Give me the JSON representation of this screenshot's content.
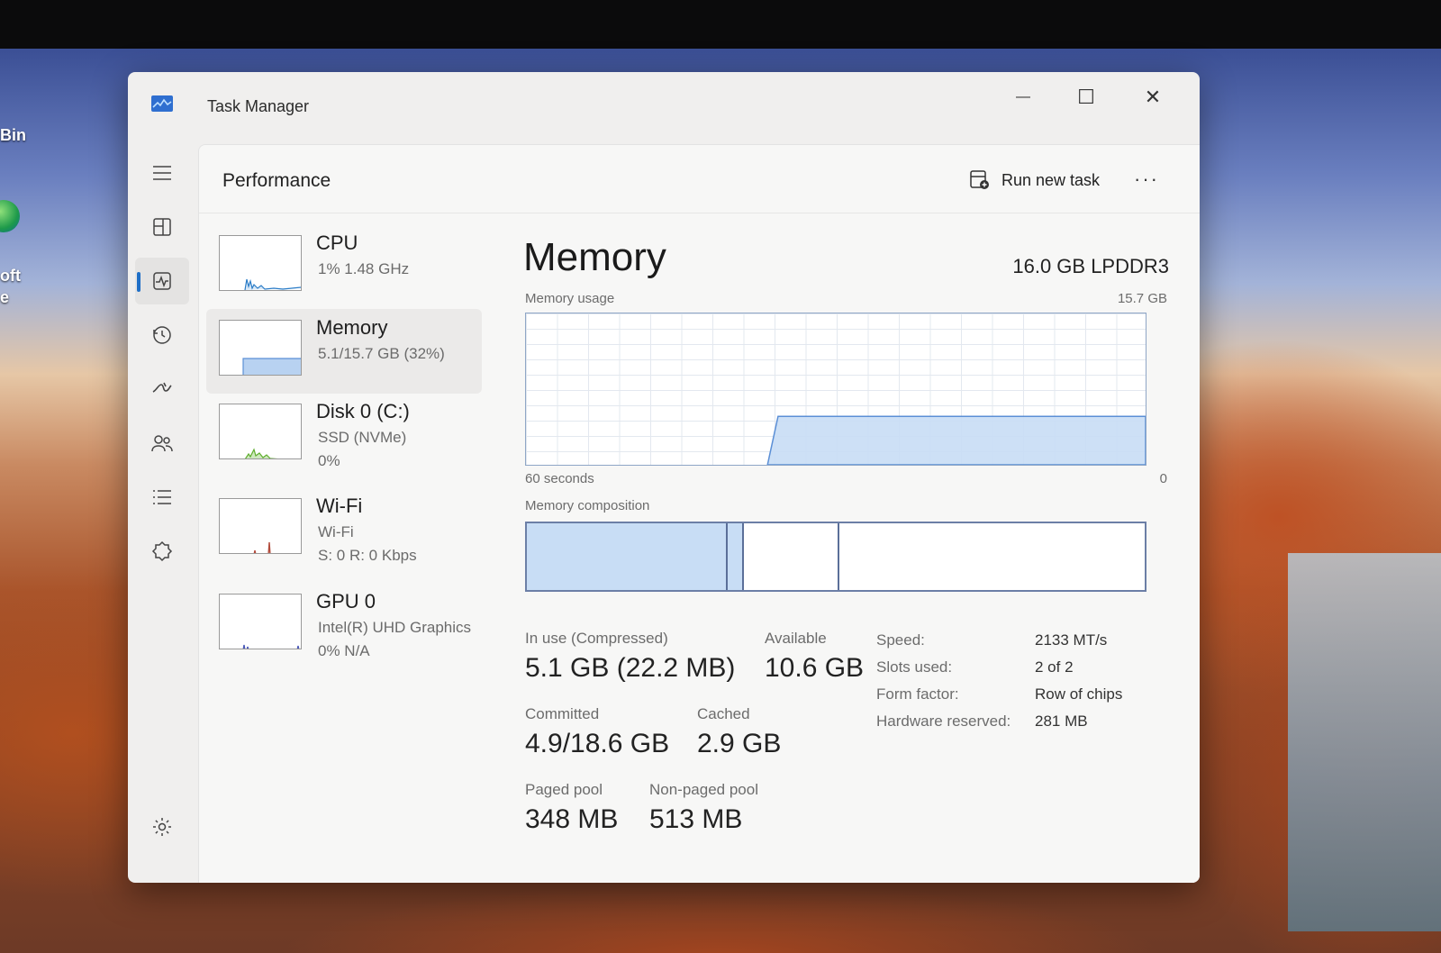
{
  "desktop": {
    "icon_labels": [
      "Bin",
      "oft",
      "e"
    ]
  },
  "window": {
    "title": "Task Manager",
    "controls": {
      "minimize": "—",
      "maximize": "☐",
      "close": "✕"
    }
  },
  "nav": {
    "items": [
      {
        "name": "menu-icon"
      },
      {
        "name": "processes-icon"
      },
      {
        "name": "performance-icon",
        "active": true
      },
      {
        "name": "app-history-icon"
      },
      {
        "name": "startup-apps-icon"
      },
      {
        "name": "users-icon"
      },
      {
        "name": "details-icon"
      },
      {
        "name": "services-icon"
      },
      {
        "name": "settings-icon"
      }
    ]
  },
  "header": {
    "title": "Performance",
    "run_new_task": "Run new task",
    "more": "···"
  },
  "devices": [
    {
      "name": "CPU",
      "sub1": "1%  1.48 GHz",
      "sub2": "",
      "sub3": "",
      "color": "#2a7cc7"
    },
    {
      "name": "Memory",
      "sub1": "5.1/15.7 GB (32%)",
      "sub2": "",
      "sub3": "",
      "color": "#5b8fd6",
      "active": true
    },
    {
      "name": "Disk 0 (C:)",
      "sub1": "SSD (NVMe)",
      "sub2": "0%",
      "sub3": "",
      "color": "#5fae2e"
    },
    {
      "name": "Wi-Fi",
      "sub1": "Wi-Fi",
      "sub2": "S: 0  R: 0 Kbps",
      "sub3": "",
      "color": "#b24a3a"
    },
    {
      "name": "GPU 0",
      "sub1": "Intel(R) UHD Graphics",
      "sub2": "0%  N/A",
      "sub3": "",
      "color": "#4a58b8"
    }
  ],
  "detail": {
    "title": "Memory",
    "spec": "16.0 GB LPDDR3",
    "usage_label": "Memory usage",
    "usage_max": "15.7 GB",
    "time_label": "60 seconds",
    "time_end": "0",
    "composition_label": "Memory composition",
    "usage_history_fraction": [
      0,
      0,
      0,
      0,
      0,
      0,
      0,
      0,
      0,
      0,
      0,
      0,
      0,
      0,
      0,
      0,
      0,
      0,
      0,
      0,
      0,
      0,
      0,
      0,
      0.32,
      0.32,
      0.32,
      0.32,
      0.32,
      0.32,
      0.32,
      0.32,
      0.32,
      0.32,
      0.32,
      0.32,
      0.32,
      0.32,
      0.32,
      0.32,
      0.32,
      0.32,
      0.32,
      0.32,
      0.32,
      0.32,
      0.32,
      0.32,
      0.32,
      0.32,
      0.32,
      0.32,
      0.32,
      0.32,
      0.32,
      0.32,
      0.32,
      0.32,
      0.32,
      0.32
    ],
    "composition": [
      {
        "name": "in-use",
        "fraction": 0.325,
        "fill": "#c8ddf5"
      },
      {
        "name": "modified",
        "fraction": 0.026,
        "fill": "#c8ddf5"
      },
      {
        "name": "standby",
        "fraction": 0.155,
        "fill": "#ffffff"
      },
      {
        "name": "free",
        "fraction": 0.494,
        "fill": "#ffffff"
      }
    ],
    "stats": {
      "in_use_label": "In use (Compressed)",
      "in_use_value": "5.1 GB (22.2 MB)",
      "available_label": "Available",
      "available_value": "10.6 GB",
      "committed_label": "Committed",
      "committed_value": "4.9/18.6 GB",
      "cached_label": "Cached",
      "cached_value": "2.9 GB",
      "paged_label": "Paged pool",
      "paged_value": "348 MB",
      "nonpaged_label": "Non-paged pool",
      "nonpaged_value": "513 MB"
    },
    "specs": [
      {
        "key": "Speed:",
        "value": "2133 MT/s"
      },
      {
        "key": "Slots used:",
        "value": "2 of 2"
      },
      {
        "key": "Form factor:",
        "value": "Row of chips"
      },
      {
        "key": "Hardware reserved:",
        "value": "281 MB"
      }
    ]
  },
  "colors": {
    "accent": "#1f6fc7",
    "memory_fill": "#c8ddf5",
    "memory_line": "#5b8fd6"
  }
}
